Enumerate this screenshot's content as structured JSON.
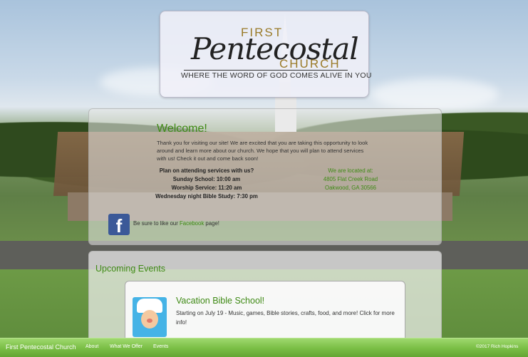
{
  "logo": {
    "first": "FIRST",
    "script": "Pentecostal",
    "church": "CHURCH",
    "tagline": "WHERE THE WORD OF GOD COMES ALIVE IN YOU"
  },
  "welcome": {
    "title": "Welcome!",
    "body": "Thank you for visiting our site! We are excited that you are taking this opportunity to look around and learn more about our church. We hope that you will plan to attend services with us! Check it out and come back soon!",
    "services_heading": "Plan on attending services with us?",
    "services": [
      "Sunday School: 10:00 am",
      "Worship Service: 11:20 am",
      "Wednesday night Bible Study: 7:30 pm"
    ],
    "location_heading": "We are located at:",
    "address_line1": "4805 Flat Creek Road",
    "address_line2": "Oakwood, GA 30566",
    "facebook_pre": "Be sure to like our ",
    "facebook_link": "Facebook",
    "facebook_post": " page!",
    "facebook_icon": "f"
  },
  "events": {
    "title": "Upcoming Events",
    "items": [
      {
        "title": "Vacation Bible School!",
        "description": "Starting on July 19 - Music, games, Bible stories, crafts, food, and more! Click for more info!"
      }
    ]
  },
  "footer": {
    "brand": "First Pentecostal Church",
    "links": [
      "About",
      "What We Offer",
      "Events"
    ],
    "copyright": "©2017 Rich Hopkins"
  },
  "colors": {
    "accent_green": "#3f8a15",
    "footer_green": "#7cc047",
    "facebook_blue": "#3b5998"
  }
}
